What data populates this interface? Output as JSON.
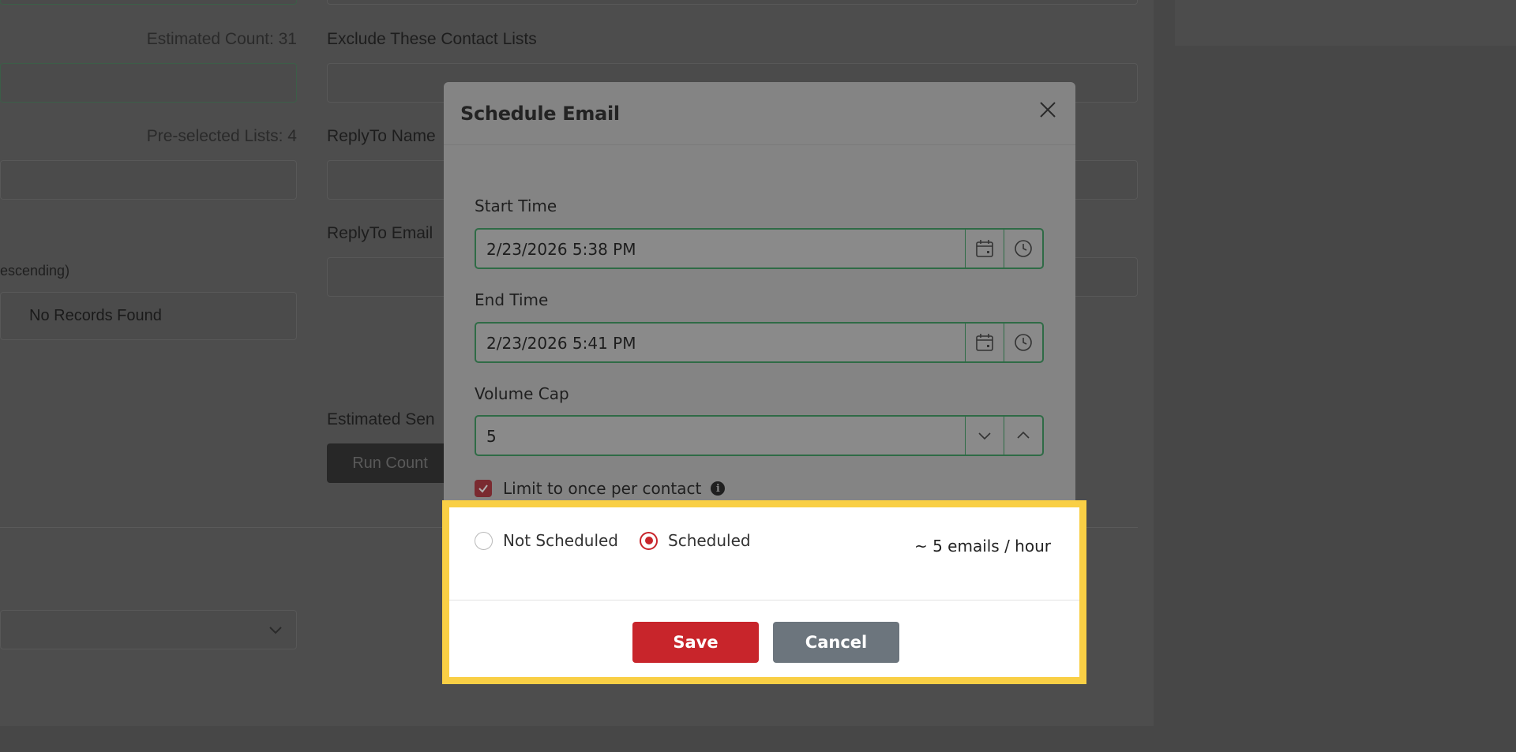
{
  "background": {
    "estimated_count_label": "Estimated Count: 31",
    "exclude_lists_label": "Exclude These Contact Lists",
    "preselected_lists_label": "Pre-selected Lists: 4",
    "replyto_name_label": "ReplyTo Name",
    "replyto_email_label": "ReplyTo Email",
    "sort_label_fragment": "escending)",
    "no_records_text": "No Records Found",
    "estimated_send_fragment": "Estimated Sen",
    "run_count_label": "Run Count"
  },
  "modal": {
    "title": "Schedule Email",
    "start_time": {
      "label": "Start Time",
      "value": "2/23/2026 5:38 PM"
    },
    "end_time": {
      "label": "End Time",
      "value": "2/23/2026 5:41 PM"
    },
    "volume_cap": {
      "label": "Volume Cap",
      "value": "5"
    },
    "limit_once_label": "Limit to once per contact",
    "limit_once_checked": true,
    "radio_options": [
      {
        "label": "Not Scheduled",
        "checked": false
      },
      {
        "label": "Scheduled",
        "checked": true
      }
    ],
    "rate_text": "~ 5 emails / hour",
    "save_label": "Save",
    "cancel_label": "Cancel"
  },
  "colors": {
    "accent_red": "#c8252b",
    "cancel_gray": "#6c757d",
    "highlight_yellow": "#f9cf45",
    "field_border_green": "#2f6b46"
  }
}
